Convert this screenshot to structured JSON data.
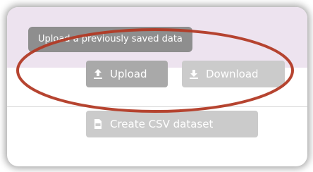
{
  "tooltip": {
    "text": "Upload a previously saved data"
  },
  "buttons": {
    "upload": {
      "label": "Upload",
      "icon": "upload-icon"
    },
    "download": {
      "label": "Download",
      "icon": "download-icon"
    },
    "create_csv": {
      "label": "Create CSV dataset",
      "icon": "csv-file-icon"
    }
  },
  "colors": {
    "header_band": "#ede3ef",
    "tooltip_bg": "#8e8e8e",
    "button_bg": "#c2c2c2",
    "annotation_ellipse": "#b23a25"
  }
}
